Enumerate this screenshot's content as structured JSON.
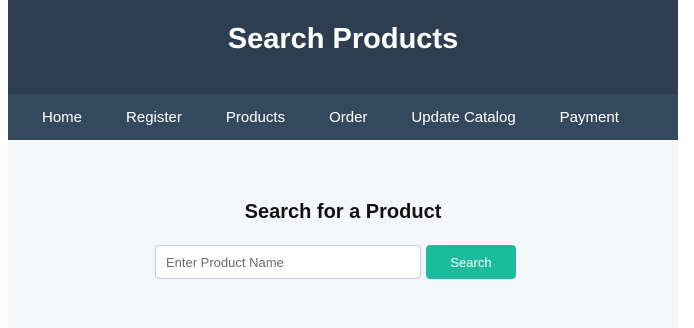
{
  "header": {
    "title": "Search Products"
  },
  "nav": {
    "items": [
      {
        "label": "Home"
      },
      {
        "label": "Register"
      },
      {
        "label": "Products"
      },
      {
        "label": "Order"
      },
      {
        "label": "Update Catalog"
      },
      {
        "label": "Payment"
      }
    ]
  },
  "main": {
    "heading": "Search for a Product",
    "search": {
      "placeholder": "Enter Product Name",
      "value": "",
      "button_label": "Search"
    }
  },
  "colors": {
    "header_bg": "#2d3e50",
    "nav_bg": "#34495e",
    "page_bg": "#f4f6f9",
    "accent": "#1abc9c"
  }
}
